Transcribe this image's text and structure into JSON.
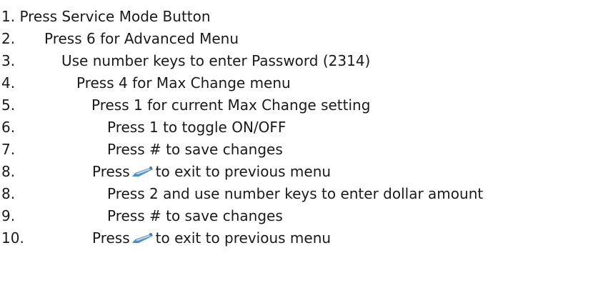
{
  "steps": [
    {
      "text": "1. Press Service Mode Button"
    },
    {
      "number": "2.",
      "text": "Press 6 for Advanced Menu"
    },
    {
      "number": "3.",
      "text": "Use number keys to enter Password (2314)"
    },
    {
      "number": "4.",
      "text": "Press 4 for Max Change menu"
    },
    {
      "number": "5.",
      "text": "Press 1 for current Max Change setting"
    },
    {
      "number": "6.",
      "text": "Press 1 to toggle ON/OFF"
    },
    {
      "number": "7.",
      "text": "Press # to save changes"
    },
    {
      "number": "8.",
      "text_before": "Press",
      "icon": "back-arrow-icon",
      "text_after": "to exit to previous menu"
    },
    {
      "number": "8.",
      "text": "Press 2 and use number keys to enter dollar amount"
    },
    {
      "number": "9.",
      "text": "Press # to save changes"
    },
    {
      "number": "10.",
      "text_before": "Press",
      "icon": "back-arrow-icon",
      "text_after": "to exit to previous menu"
    }
  ],
  "colors": {
    "text": "#1a1a1a",
    "icon_blue": "#4a90c8",
    "icon_light": "#b9d6ea"
  }
}
